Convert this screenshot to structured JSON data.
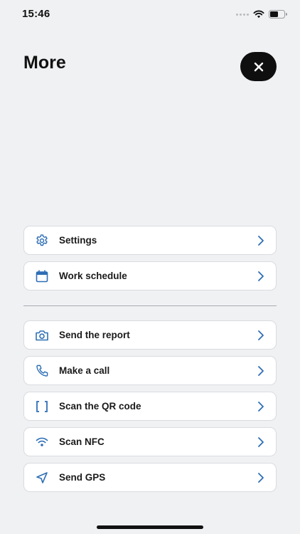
{
  "status_bar": {
    "time": "15:46"
  },
  "header": {
    "title": "More"
  },
  "colors": {
    "accent": "#2f6fb5",
    "background": "#f0f1f3",
    "card": "#ffffff",
    "close_button_bg": "#0f0f10"
  },
  "menu": {
    "primary_items": [
      {
        "label": "Settings",
        "icon": "gear-icon"
      },
      {
        "label": "Work schedule",
        "icon": "calendar-icon"
      }
    ],
    "action_items": [
      {
        "label": "Send the report",
        "icon": "camera-icon"
      },
      {
        "label": "Make a call",
        "icon": "phone-icon"
      },
      {
        "label": "Scan the QR code",
        "icon": "qr-brackets-icon"
      },
      {
        "label": "Scan NFC",
        "icon": "wifi-icon"
      },
      {
        "label": "Send GPS",
        "icon": "location-arrow-icon"
      }
    ]
  }
}
